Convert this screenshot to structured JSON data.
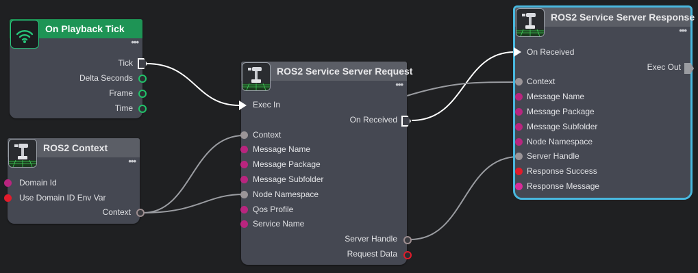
{
  "nodes": {
    "playback_tick": {
      "title": "On Playback Tick",
      "outputs": [
        "Tick",
        "Delta Seconds",
        "Frame",
        "Time"
      ]
    },
    "ros2_context": {
      "title": "ROS2 Context",
      "inputs": [
        "Domain Id",
        "Use Domain ID Env Var"
      ],
      "outputs": [
        "Context"
      ]
    },
    "service_request": {
      "title": "ROS2 Service Server Request",
      "exec_in": "Exec In",
      "on_received": "On Received",
      "inputs": [
        "Context",
        "Message Name",
        "Message Package",
        "Message Subfolder",
        "Node Namespace",
        "Qos Profile",
        "Service Name"
      ],
      "outputs": [
        "Server Handle",
        "Request Data"
      ]
    },
    "service_response": {
      "title": "ROS2 Service Server Response",
      "on_received": "On Received",
      "exec_out": "Exec Out",
      "inputs": [
        "Context",
        "Message Name",
        "Message Package",
        "Message Subfolder",
        "Node Namespace",
        "Server Handle",
        "Response Success",
        "Response Message"
      ]
    }
  },
  "menu_glyph": "•••",
  "colors": {
    "canvas": "#1f2022",
    "node_body": "#454852",
    "node_header": "#5b5e66",
    "event_header": "#1e9455",
    "selection": "#49b8df",
    "pin_green": "#21c36a",
    "pin_magenta": "#b9257f",
    "pin_red": "#e21b2b",
    "wire_exec": "#ffffff",
    "wire_data": "#9a9ca1"
  },
  "icons": [
    "wifi-signal-icon",
    "ros-robot-arm-icon"
  ]
}
